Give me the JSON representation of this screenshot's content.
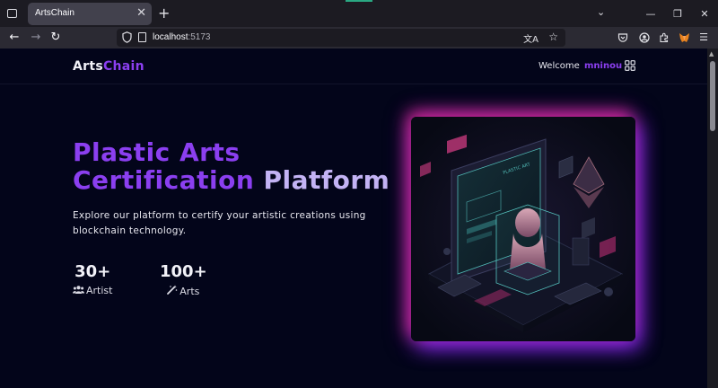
{
  "browser": {
    "tab_title": "ArtsChain",
    "url_host": "localhost",
    "url_port": ":5173"
  },
  "site": {
    "logo_part1": "Arts",
    "logo_part2": "Chain",
    "welcome_text": "Welcome",
    "username": "mninou"
  },
  "hero": {
    "title_line1": "Plastic Arts",
    "title_line2_a": "Certification",
    "title_line2_b": "Platform",
    "description": "Explore our platform to certify your artistic creations using blockchain technology."
  },
  "stats": [
    {
      "value": "30+",
      "label": "Artist",
      "icon": "users-icon"
    },
    {
      "value": "100+",
      "label": "Arts",
      "icon": "magic-wand-icon"
    }
  ],
  "colors": {
    "accent_purple": "#8b3ff0",
    "title_light": "#c3b3f4",
    "page_bg": "#03051a",
    "glow_pink": "#dc2896",
    "glow_violet": "#7828f0"
  }
}
